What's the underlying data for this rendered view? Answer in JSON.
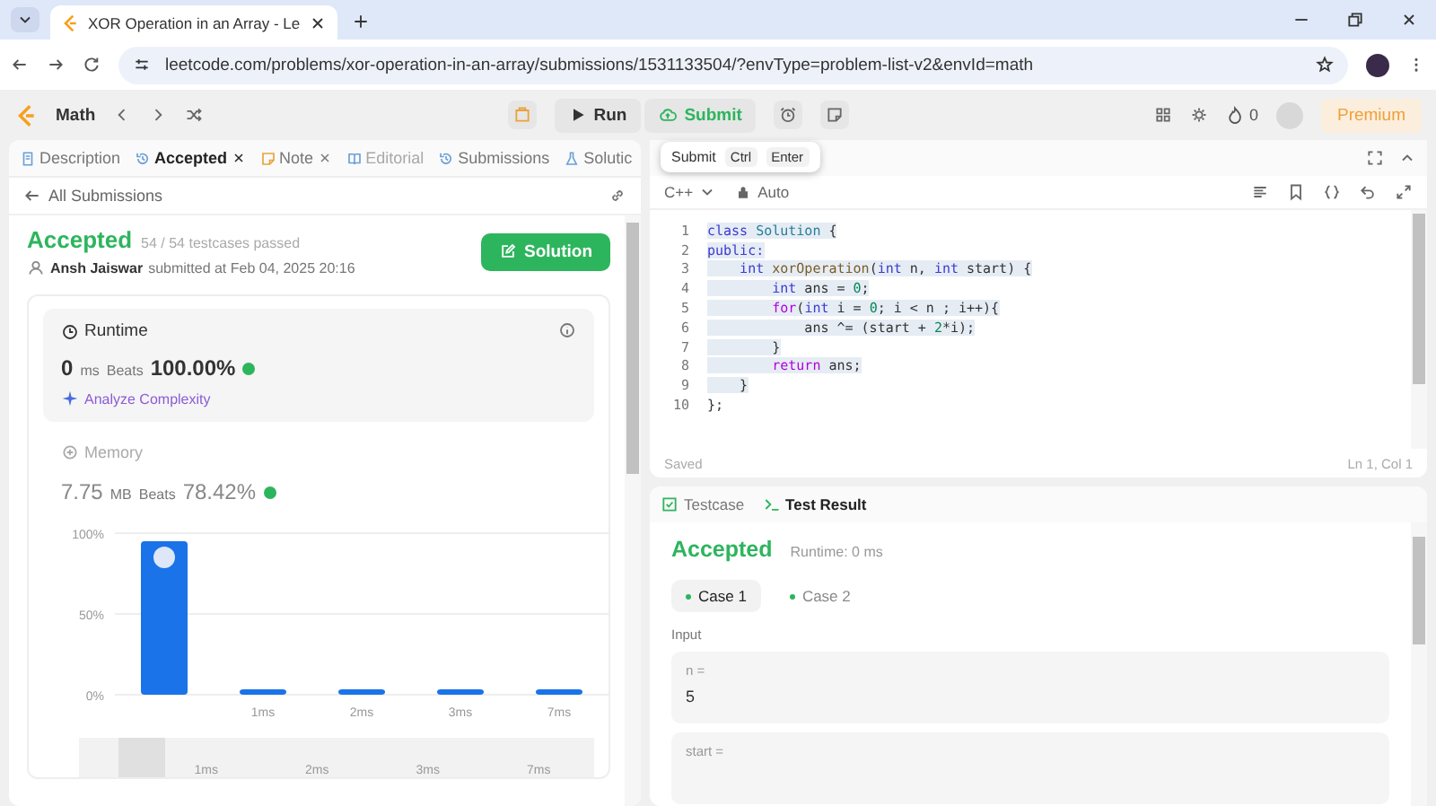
{
  "browser": {
    "tab_title": "XOR Operation in an Array - Le",
    "url": "leetcode.com/problems/xor-operation-in-an-array/submissions/1531133504/?envType=problem-list-v2&envId=math"
  },
  "nav": {
    "topic": "Math",
    "run": "Run",
    "submit": "Submit",
    "streak": "0",
    "premium": "Premium"
  },
  "left_tabs": [
    {
      "label": "Description",
      "selected": false,
      "closable": false,
      "disabled": false,
      "kind": "doc"
    },
    {
      "label": "Accepted",
      "selected": true,
      "closable": true,
      "disabled": false,
      "kind": "history"
    },
    {
      "label": "Note",
      "selected": false,
      "closable": true,
      "disabled": false,
      "kind": "note"
    },
    {
      "label": "Editorial",
      "selected": false,
      "closable": false,
      "disabled": true,
      "kind": "book"
    },
    {
      "label": "Submissions",
      "selected": false,
      "closable": false,
      "disabled": false,
      "kind": "history"
    },
    {
      "label": "Solutic",
      "selected": false,
      "closable": false,
      "disabled": false,
      "kind": "flask"
    }
  ],
  "back_link": "All Submissions",
  "result": {
    "status": "Accepted",
    "passed": "54 / 54 testcases passed",
    "user": "Ansh Jaiswar",
    "submitted": "submitted at Feb 04, 2025 20:16",
    "solution_button": "Solution"
  },
  "runtime": {
    "title": "Runtime",
    "value": "0",
    "unit": "ms",
    "beats_label": "Beats",
    "beats": "100.00%",
    "analyze": "Analyze Complexity"
  },
  "memory": {
    "title": "Memory",
    "value": "7.75",
    "unit": "MB",
    "beats_label": "Beats",
    "beats": "78.42%"
  },
  "chart_data": {
    "type": "bar",
    "categories": [
      null,
      "1ms",
      "2ms",
      "3ms",
      "7ms"
    ],
    "values": [
      95,
      2,
      2,
      2,
      2
    ],
    "ylim": [
      0,
      100
    ],
    "yticks": [
      {
        "value": 0,
        "label": "0%"
      },
      {
        "value": 50,
        "label": "50%"
      },
      {
        "value": 100,
        "label": "100%"
      }
    ]
  },
  "navigator_labels": [
    "1ms",
    "2ms",
    "3ms",
    "7ms"
  ],
  "tooltip": {
    "label": "Submit",
    "keys": [
      "Ctrl",
      "Enter"
    ]
  },
  "editor": {
    "language": "C++",
    "mode": "Auto",
    "saved": "Saved",
    "cursor": "Ln 1, Col 1",
    "lines": [
      {
        "number": "1",
        "selected": true,
        "tokens": [
          {
            "kind": "keyword",
            "text": "class"
          },
          {
            "kind": "type",
            "text": " Solution"
          },
          {
            "kind": "plain",
            "text": " {"
          }
        ]
      },
      {
        "number": "2",
        "selected": true,
        "tokens": [
          {
            "kind": "keyword",
            "text": "public:"
          }
        ]
      },
      {
        "number": "3",
        "selected": true,
        "tokens": [
          {
            "kind": "keyword",
            "text": "    int "
          },
          {
            "kind": "function",
            "text": "xorOperation"
          },
          {
            "kind": "plain",
            "text": "("
          },
          {
            "kind": "keyword",
            "text": "int"
          },
          {
            "kind": "plain",
            "text": " n, "
          },
          {
            "kind": "keyword",
            "text": "int"
          },
          {
            "kind": "plain",
            "text": " start) {"
          }
        ]
      },
      {
        "number": "4",
        "selected": true,
        "tokens": [
          {
            "kind": "keyword",
            "text": "        int"
          },
          {
            "kind": "plain",
            "text": " ans = "
          },
          {
            "kind": "number",
            "text": "0"
          },
          {
            "kind": "plain",
            "text": ";"
          }
        ]
      },
      {
        "number": "5",
        "selected": true,
        "tokens": [
          {
            "kind": "control",
            "text": "        for"
          },
          {
            "kind": "plain",
            "text": "("
          },
          {
            "kind": "keyword",
            "text": "int"
          },
          {
            "kind": "plain",
            "text": " i = "
          },
          {
            "kind": "number",
            "text": "0"
          },
          {
            "kind": "plain",
            "text": "; i < n ; i++){"
          }
        ]
      },
      {
        "number": "6",
        "selected": true,
        "tokens": [
          {
            "kind": "plain",
            "text": "            ans ^= (start + "
          },
          {
            "kind": "number",
            "text": "2"
          },
          {
            "kind": "plain",
            "text": "*i);"
          }
        ]
      },
      {
        "number": "7",
        "selected": true,
        "tokens": [
          {
            "kind": "plain",
            "text": "        }"
          }
        ]
      },
      {
        "number": "8",
        "selected": true,
        "tokens": [
          {
            "kind": "control",
            "text": "        return"
          },
          {
            "kind": "plain",
            "text": " ans;"
          }
        ]
      },
      {
        "number": "9",
        "selected": true,
        "tokens": [
          {
            "kind": "plain",
            "text": "    }"
          }
        ]
      },
      {
        "number": "10",
        "selected": false,
        "tokens": [
          {
            "kind": "plain",
            "text": "};"
          }
        ]
      }
    ]
  },
  "bottom_tabs": [
    {
      "label": "Testcase",
      "selected": false,
      "kind": "check"
    },
    {
      "label": "Test Result",
      "selected": true,
      "kind": "terminal"
    }
  ],
  "test_result": {
    "status": "Accepted",
    "runtime": "Runtime: 0 ms",
    "cases": [
      {
        "label": "Case 1",
        "selected": true
      },
      {
        "label": "Case 2",
        "selected": false
      }
    ],
    "input_label": "Input",
    "inputs": [
      {
        "name": "n =",
        "value": "5"
      },
      {
        "name": "start ="
      }
    ]
  }
}
